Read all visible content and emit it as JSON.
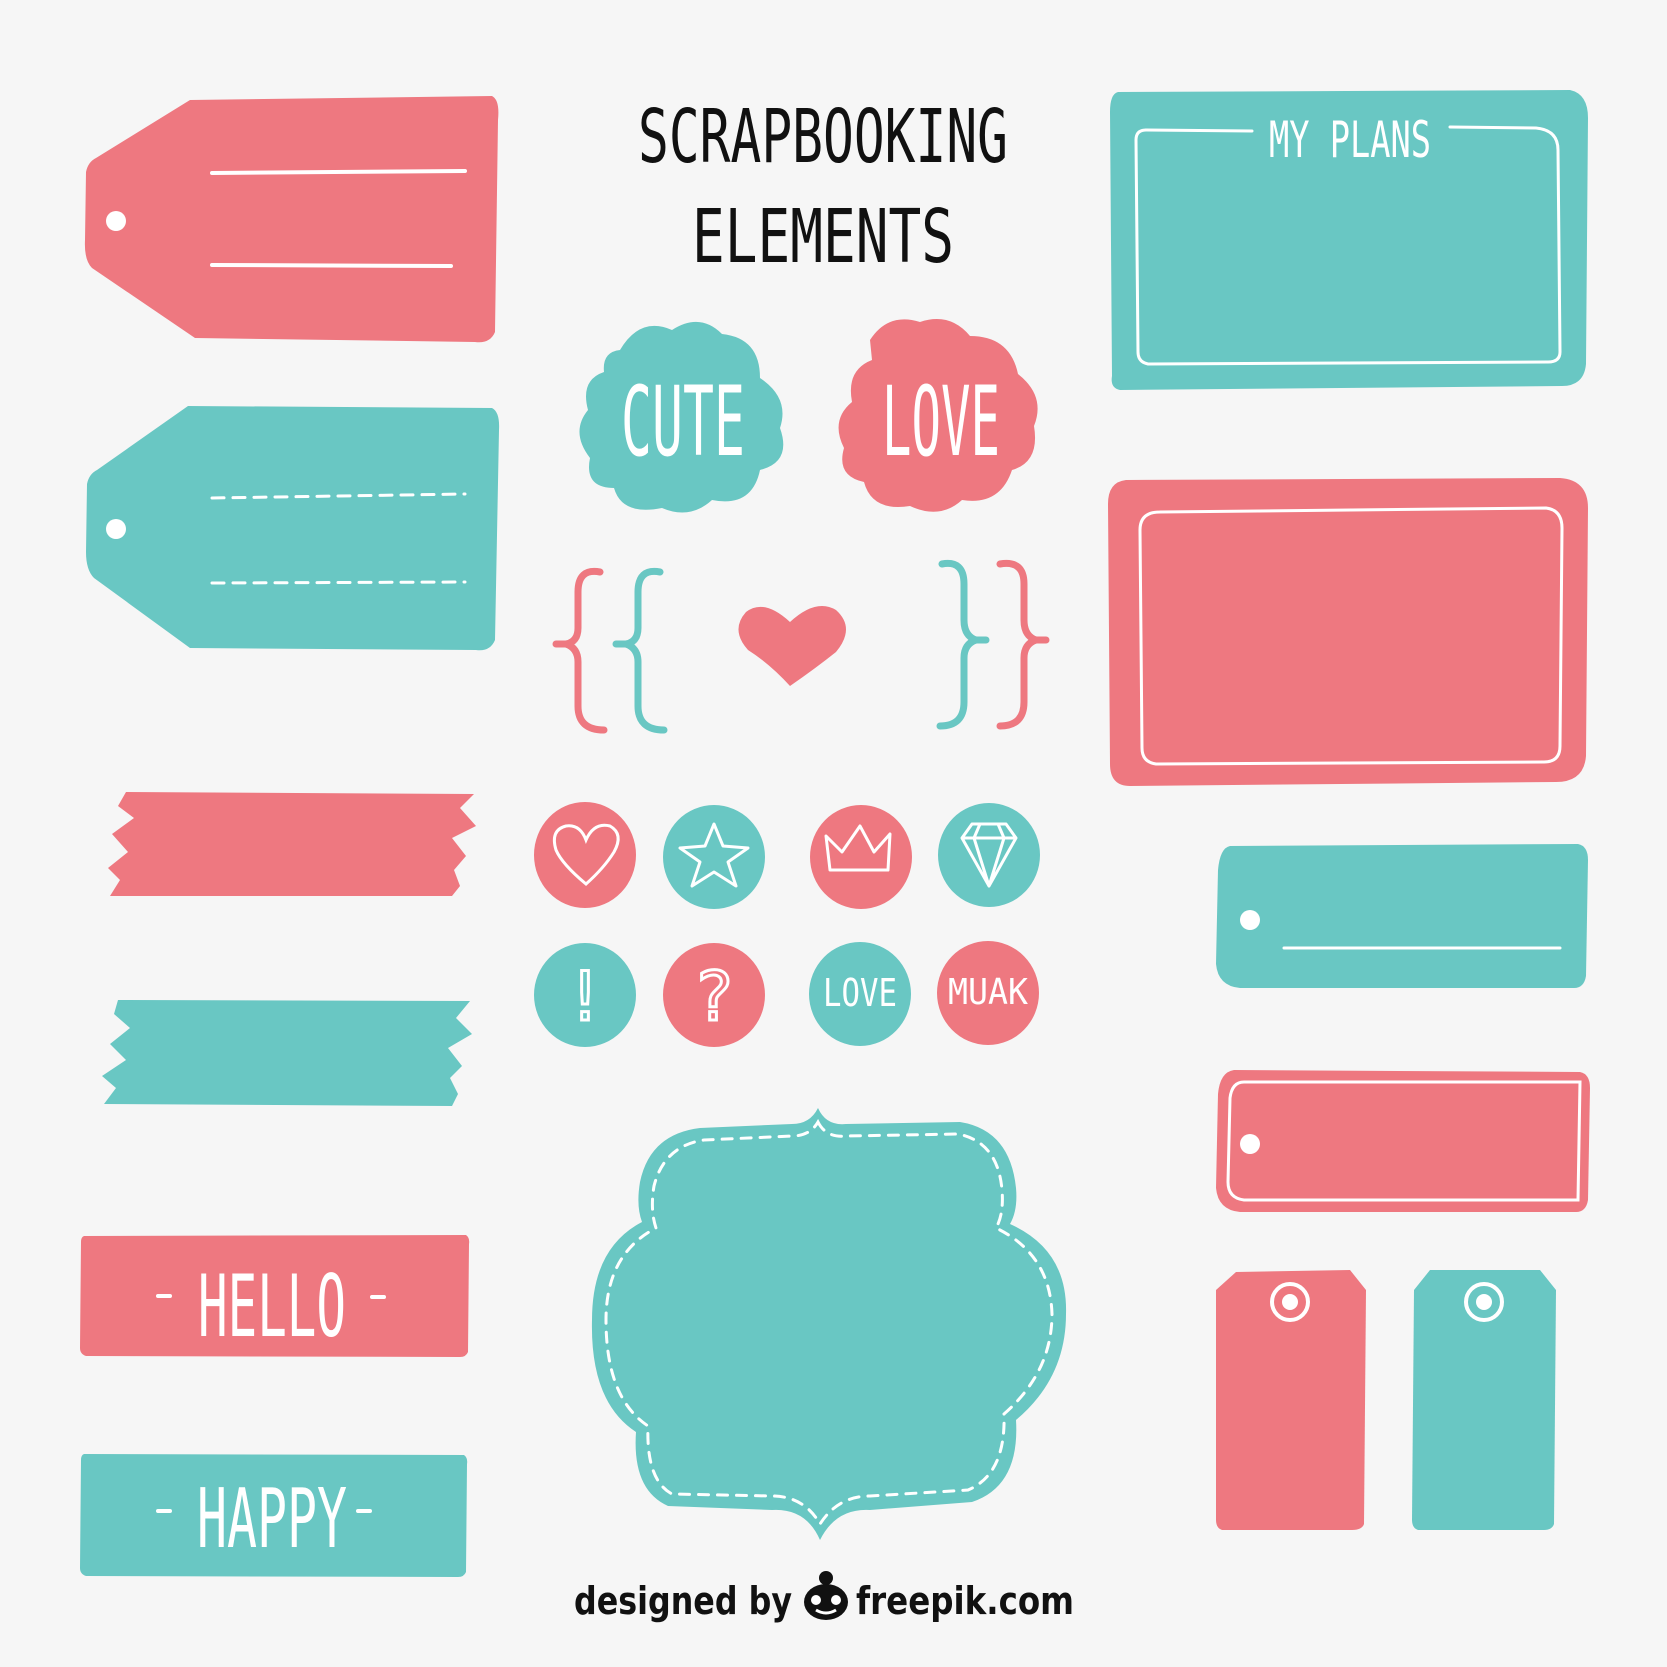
{
  "colors": {
    "background": "#f6f6f6",
    "pink": "#ee7880",
    "teal": "#69c7c3",
    "white": "#ffffff",
    "ink": "#111111"
  },
  "title": {
    "line1": "SCRAPBOOKING",
    "line2": "ELEMENTS"
  },
  "frames": {
    "my_plans_label": "MY PLANS"
  },
  "stickers": {
    "cute": "CUTE",
    "love": "LOVE"
  },
  "badges": [
    {
      "icon": "heart-icon"
    },
    {
      "icon": "star-icon"
    },
    {
      "icon": "crown-icon"
    },
    {
      "icon": "diamond-icon"
    },
    {
      "text": "!"
    },
    {
      "text": "?"
    },
    {
      "text": "LOVE"
    },
    {
      "text": "MUAK"
    }
  ],
  "labels": {
    "hello": "HELLO",
    "happy": "HAPPY"
  },
  "credit": {
    "prefix": "designed by",
    "brand": "freepik.com",
    "logo_icon": "freepik-logo-icon"
  }
}
